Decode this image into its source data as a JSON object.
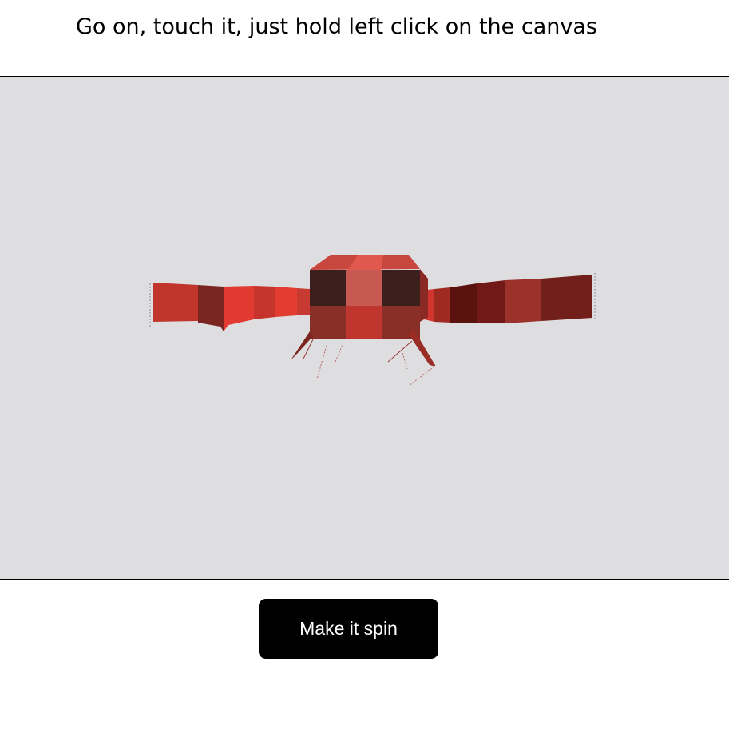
{
  "instruction": {
    "text": "Go on, touch it, just hold left click on the canvas"
  },
  "canvas": {
    "background": "#dedddf"
  },
  "spin_button": {
    "label": "Make it spin",
    "background": "#000000"
  }
}
